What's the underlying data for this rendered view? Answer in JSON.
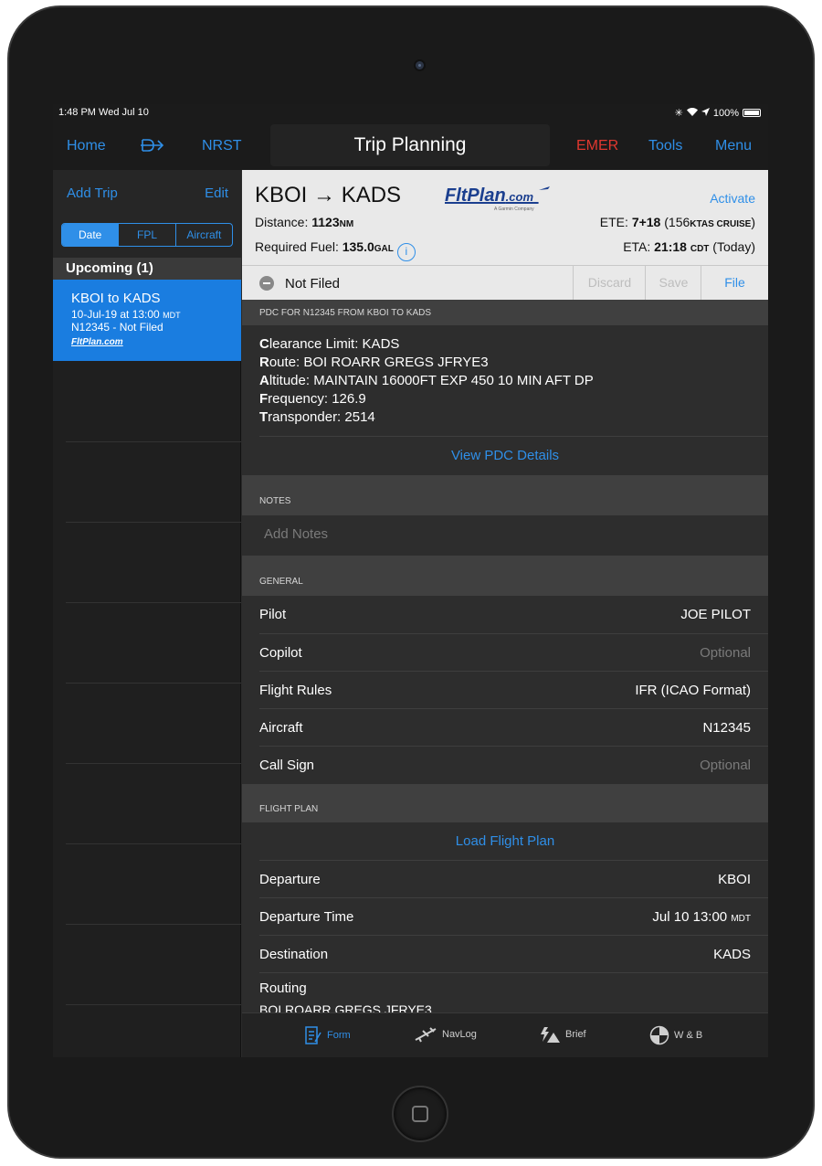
{
  "status_bar": {
    "time": "1:48 PM  Wed Jul 10",
    "battery": "100%"
  },
  "nav": {
    "home": "Home",
    "direct_to": "D→",
    "nrst": "NRST",
    "title": "Trip Planning",
    "emer": "EMER",
    "tools": "Tools",
    "menu": "Menu"
  },
  "sidebar": {
    "add_trip": "Add Trip",
    "edit": "Edit",
    "segments": [
      "Date",
      "FPL",
      "Aircraft"
    ],
    "section": "Upcoming (1)",
    "trip": {
      "title": "KBOI to KADS",
      "date": "10-Jul-19 at 13:00",
      "tz": "MDT",
      "detail": "N12345 - Not Filed",
      "logo": "FltPlan.com"
    }
  },
  "header": {
    "route": "KBOI → KADS",
    "logo": "FltPlan",
    "logo_suffix": ".com",
    "logo_sub": "A Garmin Company",
    "activate": "Activate",
    "distance_label": "Distance: ",
    "distance_value": "1123",
    "distance_unit": "NM",
    "fuel_label": "Required Fuel: ",
    "fuel_value": "135.0",
    "fuel_unit": "GAL",
    "ete_label": "ETE: ",
    "ete_value": "7+18",
    "ete_extra": " (156",
    "ete_unit": "KTAS CRUISE",
    "ete_close": ")",
    "eta_label": "ETA: ",
    "eta_value": "21:18",
    "eta_unit": "CDT",
    "eta_extra": " (Today)"
  },
  "filing": {
    "status": "Not Filed",
    "discard": "Discard",
    "save": "Save",
    "file": "File"
  },
  "pdc": {
    "header": "PDC FOR N12345 FROM KBOI TO KADS",
    "lines": [
      {
        "first": "C",
        "rest": "learance Limit: KADS"
      },
      {
        "first": "R",
        "rest": "oute: BOI ROARR GREGS JFRYE3"
      },
      {
        "first": "A",
        "rest": "ltitude: MAINTAIN 16000FT EXP 450 10 MIN AFT DP"
      },
      {
        "first": "F",
        "rest": "requency: 126.9"
      },
      {
        "first": "T",
        "rest": "ransponder: 2514"
      }
    ],
    "view_details": "View PDC Details"
  },
  "notes": {
    "header": "NOTES",
    "placeholder": "Add Notes"
  },
  "general": {
    "header": "GENERAL",
    "rows": [
      {
        "label": "Pilot",
        "value": "JOE PILOT"
      },
      {
        "label": "Copilot",
        "value": "Optional"
      },
      {
        "label": "Flight Rules",
        "value": "IFR (ICAO Format)"
      },
      {
        "label": "Aircraft",
        "value": "N12345"
      },
      {
        "label": "Call Sign",
        "value": "Optional"
      }
    ]
  },
  "flight_plan": {
    "header": "FLIGHT PLAN",
    "load": "Load Flight Plan",
    "departure_label": "Departure",
    "departure_value": "KBOI",
    "departure_time_label": "Departure Time",
    "departure_time_value": "Jul 10  13:00",
    "departure_time_tz": "MDT",
    "destination_label": "Destination",
    "destination_value": "KADS",
    "routing_label": "Routing",
    "routing_value": "BOI ROARR GREGS JFRYE3"
  },
  "tabs": [
    "Form",
    "NavLog",
    "Brief",
    "W & B"
  ],
  "colors": {
    "accent": "#2f8fe8",
    "emer": "#e0382f",
    "selected": "#1a7de0"
  }
}
